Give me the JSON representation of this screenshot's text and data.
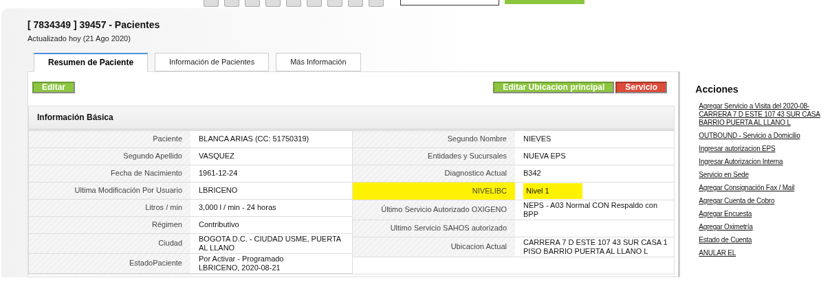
{
  "header": {
    "title": "[ 7834349 ] 39457 - Pacientes",
    "subtitle": "Actualizado hoy (21 Ago 2020)"
  },
  "tabs": [
    {
      "label": "Resumen de Paciente",
      "selected": true
    },
    {
      "label": "Información de Pacientes",
      "selected": false
    },
    {
      "label": "Más Información",
      "selected": false
    }
  ],
  "left_buttons": [
    {
      "label": "Editar",
      "kind": "green"
    }
  ],
  "right_buttons": [
    {
      "label": "Editar Ubicacion principal",
      "kind": "green"
    },
    {
      "label": "Servicio",
      "kind": "red"
    }
  ],
  "panel": {
    "title": "Información Básica",
    "left_rows": [
      {
        "label": "Paciente",
        "value": "BLANCA ARIAS (CC: 51750319)",
        "highlighted": false
      },
      {
        "label": "Segundo Apellido",
        "value": "VASQUEZ",
        "highlighted": false
      },
      {
        "label": "Fecha de Nacimiento",
        "value": "1961-12-24",
        "highlighted": false
      },
      {
        "label": "Ultima Modificación Por Usuario",
        "value": "LBRICENO",
        "highlighted": false
      },
      {
        "label": "Litros / min",
        "value": "3,000 l / min - 24 horas",
        "highlighted": false
      },
      {
        "label": "Régimen",
        "value": "Contributivo",
        "highlighted": false
      },
      {
        "label": "Ciudad",
        "value": "BOGOTA D.C. - CIUDAD USME, PUERTA AL LLANO",
        "highlighted": false
      },
      {
        "label": "EstadoPaciente",
        "value": "Por Activar - Programado\nLBRICENO, 2020-08-21",
        "highlighted": false
      }
    ],
    "right_rows": [
      {
        "label": "Segundo Nombre",
        "value": "NIEVES",
        "highlighted": false
      },
      {
        "label": "Entidades y Sucursales",
        "value": "NUEVA EPS",
        "highlighted": false
      },
      {
        "label": "Diagnostico Actual",
        "value": "B342",
        "highlighted": false
      },
      {
        "label": "NIVELIBC",
        "value": "Nivel 1",
        "highlighted": true
      },
      {
        "label": "Último Servicio Autorizado OXIGENO",
        "value": "NEPS - A03 Normal CON Respaldo con BPP",
        "highlighted": false
      },
      {
        "label": "Ultimo Servicio SAHOS autorizado",
        "value": "",
        "highlighted": false
      },
      {
        "label": "Ubicacion Actual",
        "value": "CARRERA 7 D ESTE 107 43 SUR CASA 1 PISO BARRIO PUERTA AL LLANO L",
        "highlighted": false
      }
    ]
  },
  "actions": {
    "title": "Acciones",
    "links": [
      "Agregar Servicio a Visita del 2020-08-\nCARRERA 7 D ESTE 107 43 SUR CASA\nBARRIO PUERTA AL LLANO L",
      "OUTBOUND - Servicio a Domicilio",
      "Ingresar autorizacion EPS",
      "Ingresar Autorizacion Interna",
      "Servicio en Sede",
      "Agregar Consignación Fax / Mail",
      "Agregar Cuenta de Cobro",
      "Agregar Encuesta",
      "Agregar Oximetría",
      "Estado de Cuenta",
      "ANULAR EL"
    ]
  }
}
